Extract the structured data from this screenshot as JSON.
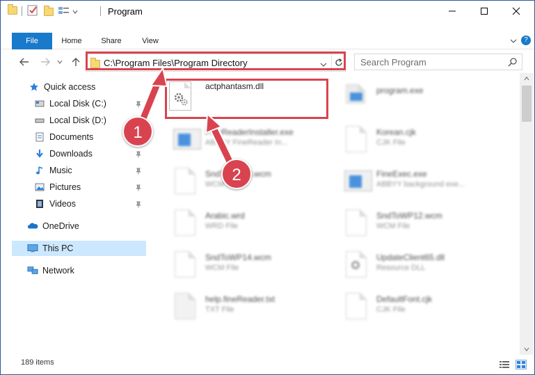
{
  "window": {
    "title": "Program"
  },
  "ribbon": {
    "tabs": [
      {
        "label": "File"
      },
      {
        "label": "Home"
      },
      {
        "label": "Share"
      },
      {
        "label": "View"
      }
    ]
  },
  "navigation": {
    "address_path": "C:\\Program Files\\Program Directory",
    "search_placeholder": "Search Program"
  },
  "sidebar": {
    "items": [
      {
        "label": "Quick access",
        "icon": "star-icon"
      },
      {
        "label": "Local Disk (C:)",
        "icon": "drive-icon",
        "pinned": true
      },
      {
        "label": "Local Disk (D:)",
        "icon": "drive-icon",
        "pinned": false
      },
      {
        "label": "Documents",
        "icon": "documents-icon",
        "pinned": true
      },
      {
        "label": "Downloads",
        "icon": "download-icon",
        "pinned": true
      },
      {
        "label": "Music",
        "icon": "music-icon",
        "pinned": true
      },
      {
        "label": "Pictures",
        "icon": "pictures-icon",
        "pinned": true
      },
      {
        "label": "Videos",
        "icon": "videos-icon",
        "pinned": true
      },
      {
        "label": "OneDrive",
        "icon": "cloud-icon"
      },
      {
        "label": "This PC",
        "icon": "computer-icon",
        "selected": true
      },
      {
        "label": "Network",
        "icon": "network-icon"
      }
    ]
  },
  "files": [
    {
      "name": "actphantasm.dll",
      "type": "",
      "icon": "dll-file-icon",
      "highlighted": true
    },
    {
      "name": "program.exe",
      "type": "",
      "icon": "exe-file-icon"
    },
    {
      "name": "FineReaderInstaller.exe",
      "type": "ABBYY FineReader In...",
      "icon": "exe-file-icon"
    },
    {
      "name": "Korean.cjk",
      "type": "CJK File",
      "icon": "document-file-icon"
    },
    {
      "name": "SndToWP13.wcm",
      "type": "WCM File",
      "icon": "document-file-icon"
    },
    {
      "name": "FineExec.exe",
      "type": "ABBYY background exe...",
      "icon": "exe-file-icon"
    },
    {
      "name": "Arabic.wrd",
      "type": "WRD File",
      "icon": "document-file-icon"
    },
    {
      "name": "SndToWP12.wcm",
      "type": "WCM File",
      "icon": "document-file-icon"
    },
    {
      "name": "SndToWP14.wcm",
      "type": "WCM File",
      "icon": "document-file-icon"
    },
    {
      "name": "UpdateClient65.dll",
      "type": "Resource DLL",
      "icon": "dll-file-icon"
    },
    {
      "name": "help.fineReader.txt",
      "type": "TXT File",
      "icon": "text-file-icon"
    },
    {
      "name": "DefaultFont.cjk",
      "type": "CJK File",
      "icon": "document-file-icon"
    }
  ],
  "status": {
    "item_count": "189 items"
  },
  "annotations": {
    "step1": "1",
    "step2": "2"
  },
  "colors": {
    "accent": "#1979ca",
    "highlight": "#d9434f",
    "selection": "#cce8ff"
  }
}
